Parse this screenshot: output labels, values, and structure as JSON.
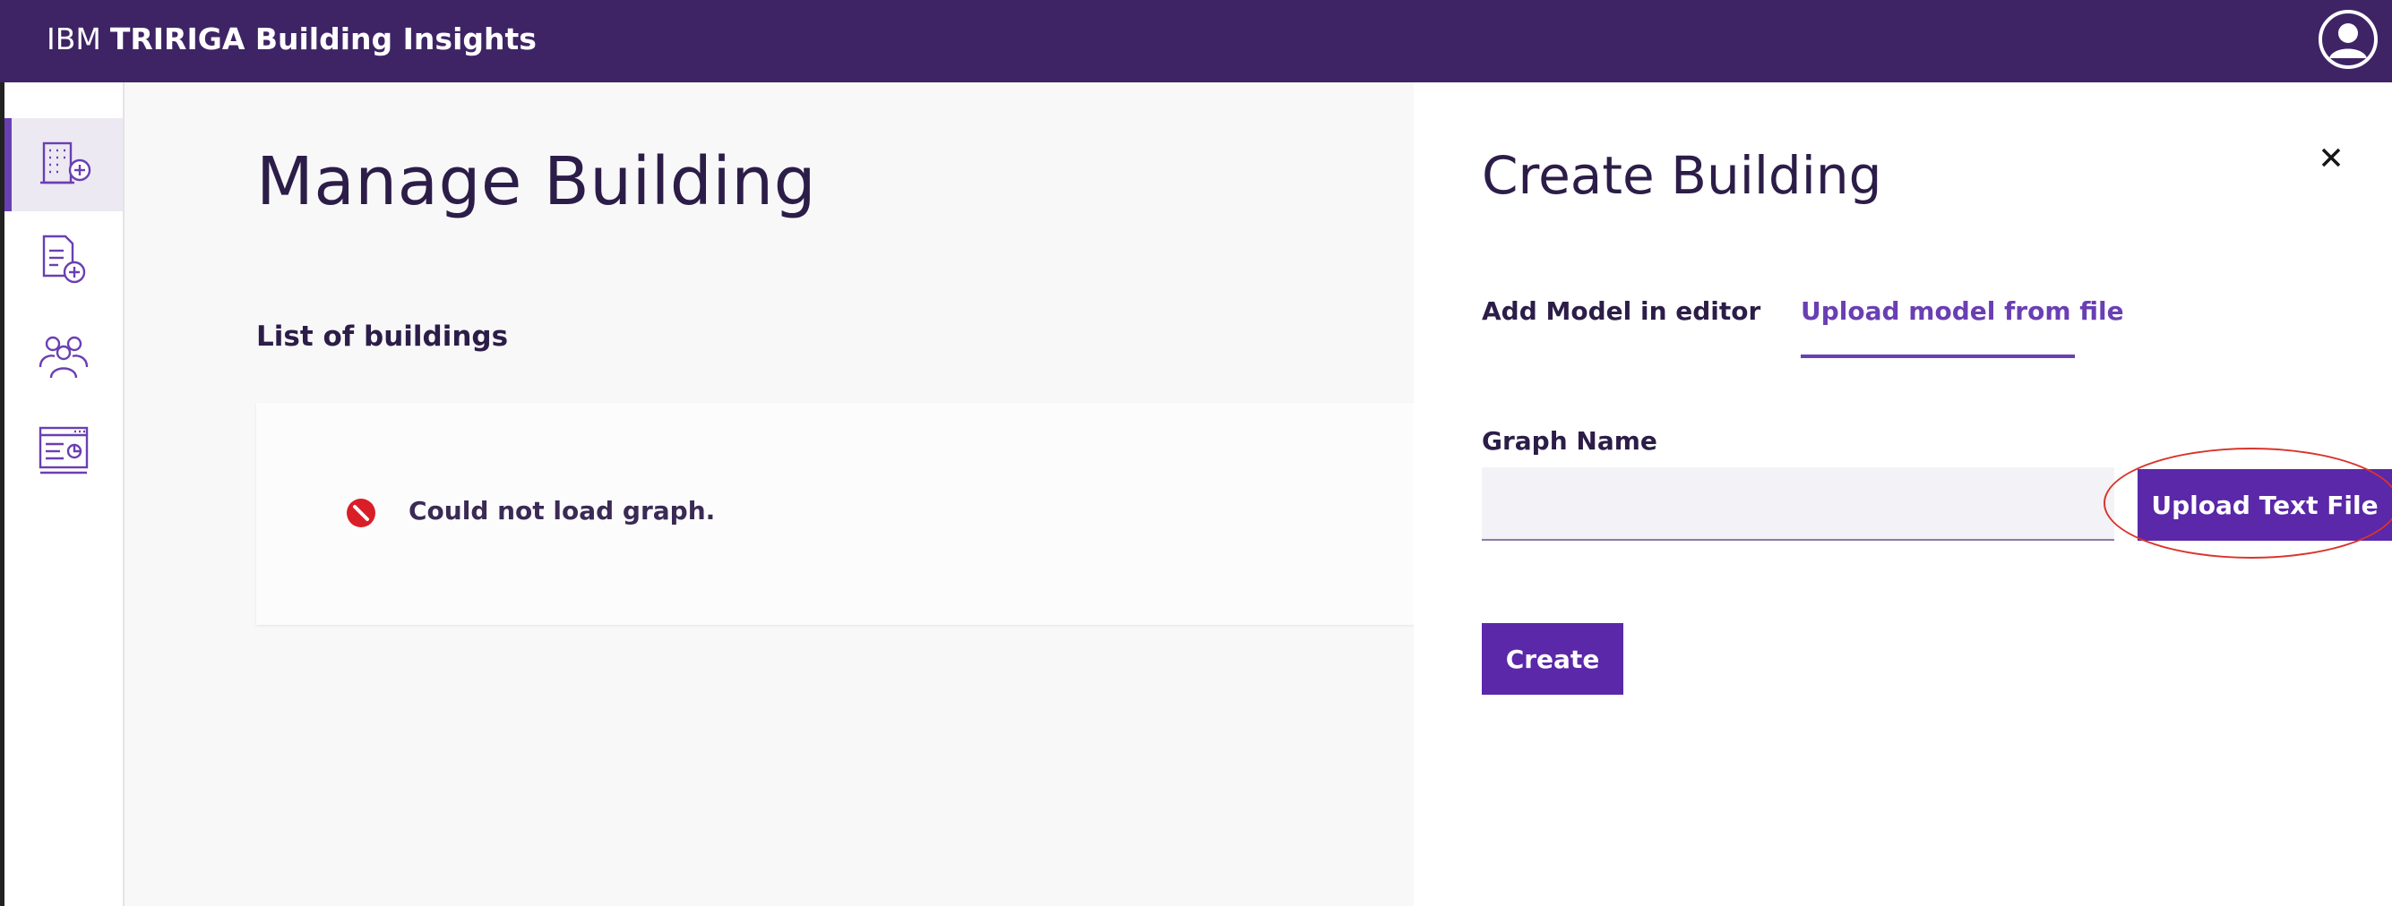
{
  "header": {
    "brand_prefix": "IBM",
    "brand_name": "TRIRIGA Building Insights",
    "background_color": "#3e2465",
    "user_icon": "user-avatar-icon"
  },
  "sidebar": {
    "items": [
      {
        "icon": "building-add-icon",
        "active": true
      },
      {
        "icon": "document-add-icon",
        "active": false
      },
      {
        "icon": "users-icon",
        "active": false
      },
      {
        "icon": "dashboard-icon",
        "active": false
      }
    ]
  },
  "main": {
    "title": "Manage Building",
    "section_title": "List of buildings",
    "error_message": "Could not load graph.",
    "error_icon": "blocked-error-icon",
    "error_color": "#da1e28"
  },
  "panel": {
    "title": "Create Building",
    "close_icon": "close-icon",
    "tabs": [
      {
        "label": "Add Model in editor",
        "selected": false
      },
      {
        "label": "Upload model from file",
        "selected": true
      }
    ],
    "field_label": "Graph Name",
    "field_value": "",
    "field_placeholder": "",
    "upload_button_label": "Upload Text File",
    "create_button_label": "Create",
    "accent_color": "#5a28a8",
    "highlight_color": "#d9342b"
  }
}
